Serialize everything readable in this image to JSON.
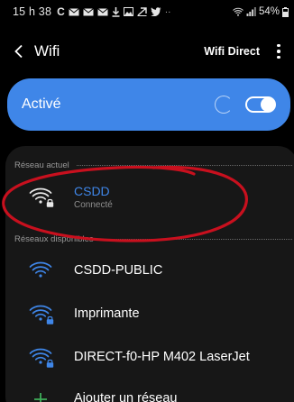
{
  "status_bar": {
    "time": "15 h 38",
    "battery": "54%"
  },
  "header": {
    "back_icon": "chevron-left",
    "title": "Wifi",
    "wifi_direct_label": "Wifi Direct",
    "more_icon": "more-vertical"
  },
  "toggle": {
    "label": "Activé",
    "state": "on",
    "scanning": true
  },
  "current_section": {
    "header": "Réseau actuel",
    "network": {
      "name": "CSDD",
      "status": "Connecté",
      "secured": true,
      "icon": "wifi-lock-icon"
    }
  },
  "available_section": {
    "header": "Réseaux disponibles",
    "networks": [
      {
        "name": "CSDD-PUBLIC",
        "secured": false,
        "icon": "wifi-icon"
      },
      {
        "name": "Imprimante",
        "secured": true,
        "icon": "wifi-lock-icon"
      },
      {
        "name": "DIRECT-f0-HP M402 LaserJet",
        "secured": true,
        "icon": "wifi-lock-icon"
      }
    ],
    "add_label": "Ajouter un réseau",
    "add_icon": "plus-icon"
  },
  "colors": {
    "accent": "#3f86e8",
    "annotation": "#c8101e",
    "panel": "#171717",
    "background": "#000000"
  }
}
